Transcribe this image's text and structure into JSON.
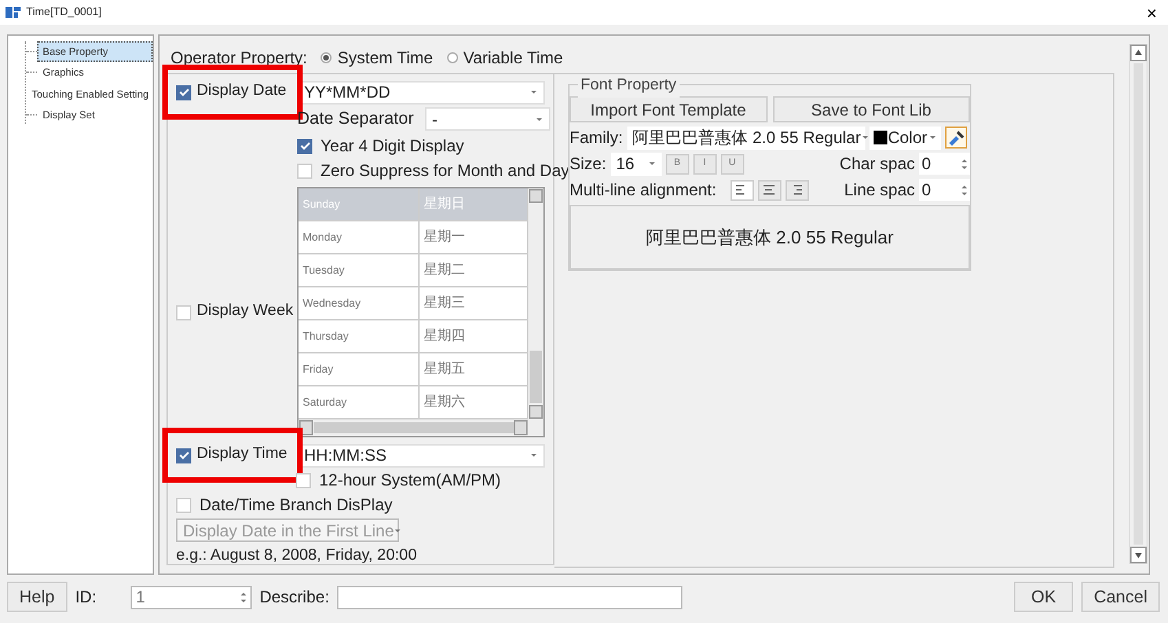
{
  "window": {
    "title": "Time[TD_0001]",
    "close": "×"
  },
  "sidebar": {
    "items": [
      {
        "label": "Base Property",
        "selected": true
      },
      {
        "label": "Graphics",
        "selected": false
      },
      {
        "label": "Touching Enabled Setting",
        "selected": false
      },
      {
        "label": "Display Set",
        "selected": false
      }
    ]
  },
  "operator_property": {
    "label": "Operator Property:",
    "options": [
      {
        "label": "System Time",
        "selected": true
      },
      {
        "label": "Variable Time",
        "selected": false
      }
    ]
  },
  "date": {
    "label": "Display Date",
    "checked": true,
    "highlighted": true,
    "format": "YY*MM*DD",
    "separator_label": "Date Separator",
    "separator": "-",
    "options": [
      {
        "label": "Year 4 Digit Display",
        "checked": true
      },
      {
        "label": "Zero Suppress for Month and Day",
        "checked": false
      }
    ]
  },
  "week": {
    "label": "Display Week",
    "checked": false,
    "rows": [
      {
        "english": "Sunday",
        "chinese": "星期日",
        "selected": true
      },
      {
        "english": "Monday",
        "chinese": "星期一",
        "selected": false
      },
      {
        "english": "Tuesday",
        "chinese": "星期二",
        "selected": false
      },
      {
        "english": "Wednesday",
        "chinese": "星期三",
        "selected": false
      },
      {
        "english": "Thursday",
        "chinese": "星期四",
        "selected": false
      },
      {
        "english": "Friday",
        "chinese": "星期五",
        "selected": false
      },
      {
        "english": "Saturday",
        "chinese": "星期六",
        "selected": false
      }
    ]
  },
  "time": {
    "label": "Display Time",
    "checked": true,
    "highlighted": true,
    "format": "HH:MM:SS",
    "twelve_hour": {
      "label": "12-hour System(AM/PM)",
      "checked": false
    }
  },
  "branch": {
    "label": "Date/Time Branch DisPlay",
    "checked": false,
    "mode": "Display Date in the First Line",
    "mode_disabled": true,
    "example": "e.g.: August 8, 2008, Friday, 20:00"
  },
  "font_property": {
    "title": "Font Property",
    "buttons": [
      "Import  Font Template",
      "Save to Font Lib"
    ],
    "family_label": "Family:",
    "family": "阿里巴巴普惠体 2.0 55 Regular",
    "color_label": "Color",
    "color": "#000000",
    "size_label": "Size:",
    "size": "16",
    "styles": [
      {
        "label": "B",
        "on": false
      },
      {
        "label": "I",
        "on": false
      },
      {
        "label": "U",
        "on": false
      }
    ],
    "char_spacing_label": "Char spac",
    "char_spacing": "0",
    "alignment_label": "Multi-line alignment:",
    "alignments": [
      {
        "kind": "left",
        "selected": true
      },
      {
        "kind": "center",
        "selected": false
      },
      {
        "kind": "right",
        "selected": false
      }
    ],
    "line_spacing_label": "Line spac",
    "line_spacing": "0",
    "preview": "阿里巴巴普惠体 2.0 55 Regular"
  },
  "footer": {
    "help": "Help",
    "id_label": "ID:",
    "id": "1",
    "describe_label": "Describe:",
    "ok": "OK",
    "cancel": "Cancel"
  }
}
